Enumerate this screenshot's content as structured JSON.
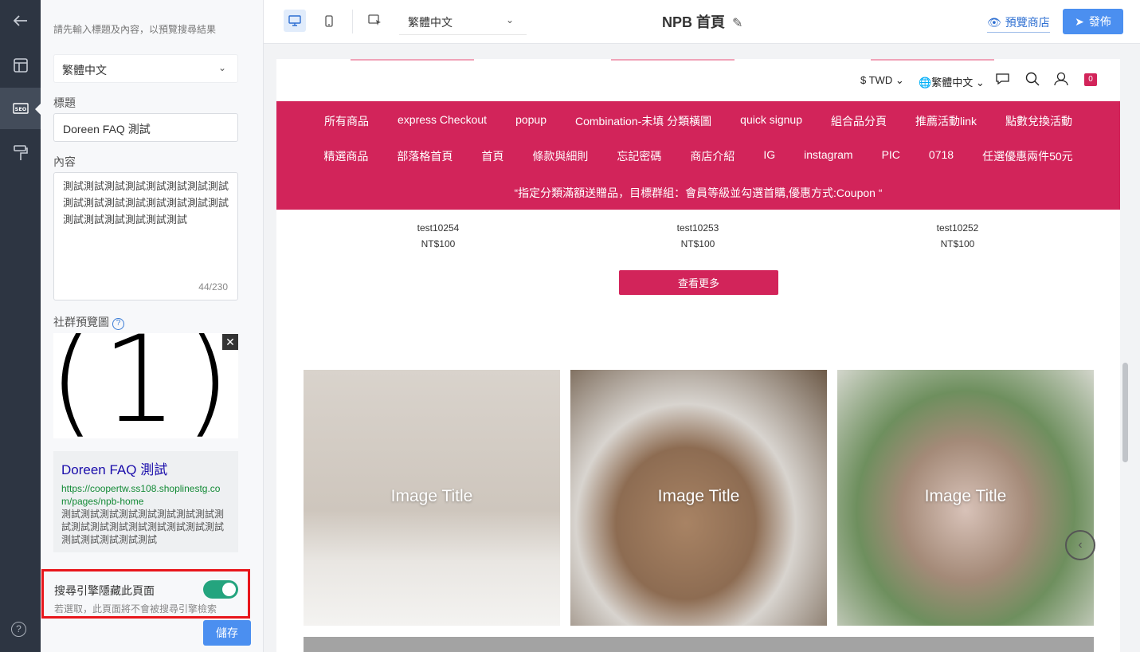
{
  "rail": {
    "items": [
      {
        "name": "back-arrow-icon",
        "glyph": "←"
      },
      {
        "name": "layout-icon",
        "glyph": "▦"
      },
      {
        "name": "seo-icon",
        "glyph": "SEO"
      },
      {
        "name": "paint-roller-icon",
        "glyph": "🖌"
      }
    ],
    "help": "?"
  },
  "panel": {
    "hint": "請先輸入標題及內容，以預覽搜尋結果",
    "language_select": "繁體中文",
    "title_label": "標題",
    "title_value": "Doreen FAQ 測試",
    "content_label": "內容",
    "content_value": "測試測試測試測試測試測試測試測試測試測試測試測試測試測試測試測試測試測試測試測試測試測試",
    "char_count": "44/230",
    "og_label": "社群預覽圖",
    "og_image_text": "(1)",
    "serp": {
      "title": "Doreen FAQ 測試",
      "url": "https://coopertw.ss108.shoplinestg.com/pages/npb-home",
      "desc": "測試測試測試測試測試測試測試測試測試測試測試測試測試測試測試測試測試測試測試測試測試測試"
    },
    "hide_title": "搜尋引擎隱藏此頁面",
    "hide_sub": "若選取，此頁面將不會被搜尋引擎檢索",
    "hide_enabled": true,
    "save": "儲存"
  },
  "topbar": {
    "lang": "繁體中文",
    "page_title": "NPB 首頁",
    "preview": "預覽商店",
    "publish": "發佈"
  },
  "store": {
    "currency": "$ TWD",
    "language": "繁體中文",
    "cart_count": "0",
    "menu_row1": [
      "所有商品",
      "express Checkout",
      "popup",
      "Combination-未填 分類橫圖",
      "quick signup",
      "組合品分頁",
      "推薦活動link",
      "點數兌換活動"
    ],
    "menu_row2": [
      "精選商品",
      "部落格首頁",
      "首頁",
      "條款與細則",
      "忘記密碼",
      "商店介紹",
      "IG",
      "instagram",
      "PIC",
      "0718",
      "任選優惠兩件50元"
    ],
    "promo": "“指定分類滿額送贈品，目標群組：會員等級並勾選首購,優惠方式:Coupon “",
    "products": [
      {
        "name": "test10254",
        "price": "NT$100"
      },
      {
        "name": "test10253",
        "price": "NT$100"
      },
      {
        "name": "test10252",
        "price": "NT$100"
      }
    ],
    "view_more": "查看更多",
    "cards": [
      "Image Title",
      "Image Title",
      "Image Title"
    ]
  },
  "colors": {
    "accent": "#d2245a",
    "primary": "#4b8ff0",
    "toggle": "#24a47e",
    "highlight": "#e8161b"
  }
}
